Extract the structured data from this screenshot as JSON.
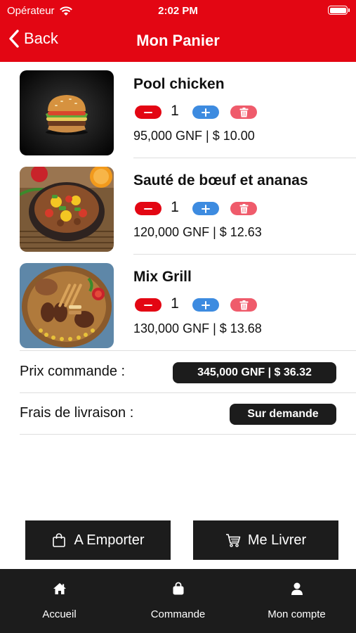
{
  "status": {
    "carrier": "Opérateur",
    "time": "2:02 PM"
  },
  "nav": {
    "back_label": "Back",
    "title": "Mon Panier"
  },
  "cart": {
    "items": [
      {
        "name": "Pool chicken",
        "quantity": "1",
        "price": "95,000 GNF | $ 10.00"
      },
      {
        "name": "Sauté de bœuf et ananas",
        "quantity": "1",
        "price": "120,000 GNF | $ 12.63"
      },
      {
        "name": "Mix Grill",
        "quantity": "1",
        "price": "130,000 GNF | $ 13.68"
      }
    ]
  },
  "summary": {
    "order_price_label": "Prix commande :",
    "order_price_value": "345,000 GNF | $ 36.32",
    "delivery_label": "Frais de livraison :",
    "delivery_value": "Sur demande"
  },
  "actions": {
    "takeaway_label": "A Emporter",
    "deliver_label": "Me Livrer"
  },
  "tabs": [
    {
      "label": "Accueil",
      "icon": "home-icon"
    },
    {
      "label": "Commande",
      "icon": "bag-icon"
    },
    {
      "label": "Mon compte",
      "icon": "user-icon"
    }
  ],
  "colors": {
    "brand_red": "#e30613",
    "plus_blue": "#3d8be0",
    "trash_pink": "#ef5b6b",
    "dark": "#1c1c1c"
  }
}
